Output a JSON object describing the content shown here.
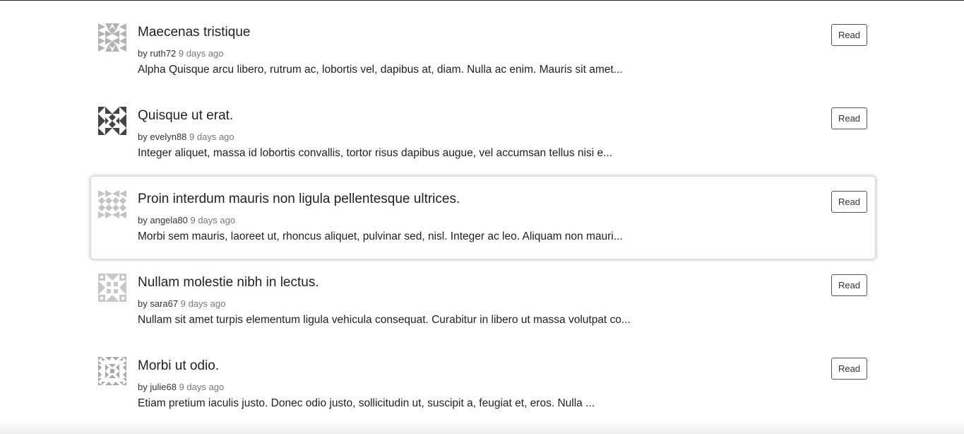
{
  "posts": [
    {
      "title": "Maecenas tristique",
      "by": "by",
      "author": "ruth72",
      "time": "9 days ago",
      "excerpt": "Alpha Quisque arcu libero, rutrum ac, lobortis vel, dapibus at, diam. Nulla ac enim. Mauris sit amet...",
      "read_label": "Read",
      "avatar_color": "#b3b3b3"
    },
    {
      "title": "Quisque ut erat.",
      "by": "by",
      "author": "evelyn88",
      "time": "9 days ago",
      "excerpt": "Integer aliquet, massa id lobortis convallis, tortor risus dapibus augue, vel accumsan tellus nisi e...",
      "read_label": "Read",
      "avatar_color": "#444444"
    },
    {
      "title": "Proin interdum mauris non ligula pellentesque ultrices.",
      "by": "by",
      "author": "angela80",
      "time": "9 days ago",
      "excerpt": "Morbi sem mauris, laoreet ut, rhoncus aliquet, pulvinar sed, nisl. Integer ac leo. Aliquam non mauri...",
      "read_label": "Read",
      "avatar_color": "#c4c4c4"
    },
    {
      "title": "Nullam molestie nibh in lectus.",
      "by": "by",
      "author": "sara67",
      "time": "9 days ago",
      "excerpt": "Nullam sit amet turpis elementum ligula vehicula consequat. Curabitur in libero ut massa volutpat co...",
      "read_label": "Read",
      "avatar_color": "#c8c8c8"
    },
    {
      "title": "Morbi ut odio.",
      "by": "by",
      "author": "julie68",
      "time": "9 days ago",
      "excerpt": "Etiam pretium iaculis justo. Donec odio justo, sollicitudin ut, suscipit a, feugiat et, eros. Nulla ...",
      "read_label": "Read",
      "avatar_color": "#a8a8a8"
    }
  ]
}
